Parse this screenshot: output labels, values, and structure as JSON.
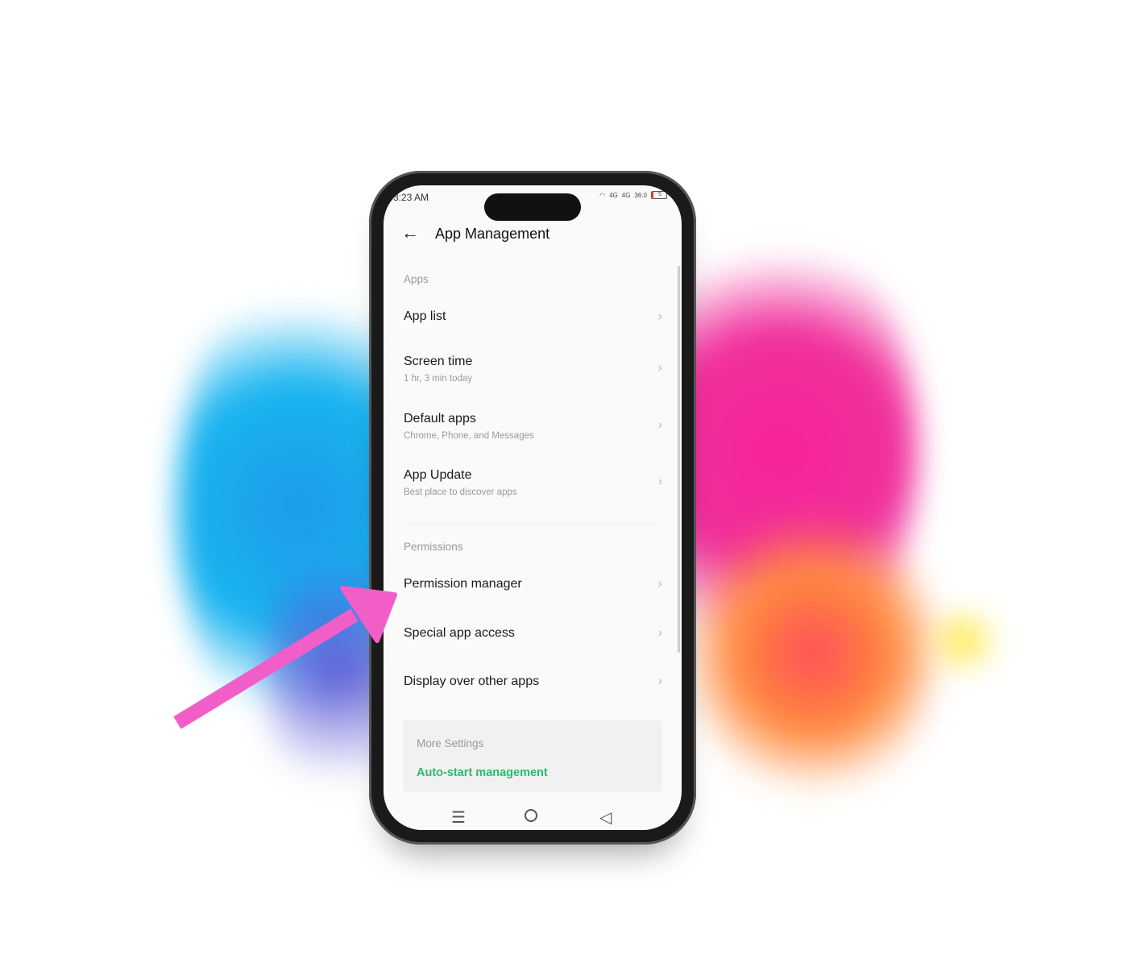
{
  "status": {
    "time": "3:23 AM",
    "net1": "4G",
    "net2": "4G",
    "speed": "36.0",
    "battery": "5"
  },
  "header": {
    "title": "App Management"
  },
  "sections": {
    "apps": "Apps",
    "permissions": "Permissions"
  },
  "items": [
    {
      "label": "App list",
      "sub": ""
    },
    {
      "label": "Screen time",
      "sub": "1 hr, 3 min today"
    },
    {
      "label": "Default apps",
      "sub": "Chrome, Phone, and Messages"
    },
    {
      "label": "App Update",
      "sub": "Best place to discover apps"
    },
    {
      "label": "Permission manager",
      "sub": ""
    },
    {
      "label": "Special app access",
      "sub": ""
    },
    {
      "label": "Display over other apps",
      "sub": ""
    }
  ],
  "more": {
    "title": "More Settings",
    "link": "Auto-start management"
  },
  "colors": {
    "accent": "#2fb86b",
    "arrow": "#f25ec8"
  }
}
